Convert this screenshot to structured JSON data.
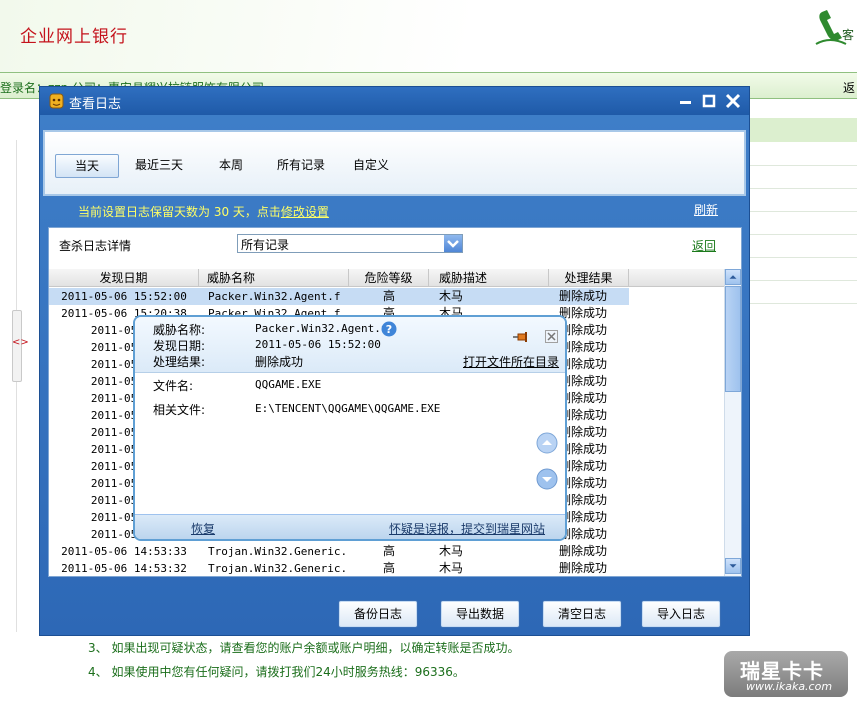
{
  "bank": {
    "title": "企业网上银行",
    "phone_label": "客",
    "login_label": "登录名：",
    "company_text": "zzp   公司：惠安县耀兴拉链服饰有限公司",
    "back_label": "返",
    "notices": [
      "3、 如果出现可疑状态，请查看您的账户余额或账户明细，以确定转账是否成功。",
      "4、 如果使用中您有任何疑问，请拨打我们24小时服务热线：96336。"
    ],
    "left_tab": "<>"
  },
  "dialog": {
    "title": "查看日志",
    "tabs": [
      "当天",
      "最近三天",
      "本周",
      "所有记录",
      "自定义"
    ],
    "retention_prefix": "当前设置日志保留天数为 30 天，点击",
    "retention_link": "修改设置",
    "refresh": "刷新",
    "detail_label": "查杀日志详情",
    "filter_value": "所有记录",
    "return": "返回",
    "columns": [
      "发现日期",
      "威胁名称",
      "危险等级",
      "威胁描述",
      "处理结果"
    ],
    "rows": [
      {
        "date": "2011-05-06 15:52:00",
        "name": "Packer.Win32.Agent.f",
        "level": "高",
        "desc": "木马",
        "result": "删除成功"
      },
      {
        "date": "2011-05-06 15:20:38",
        "name": "Packer.Win32.Agent.f",
        "level": "高",
        "desc": "木马",
        "result": "删除成功"
      },
      {
        "date": "2011-05-06",
        "name": "",
        "level": "",
        "desc": "",
        "result": "删除成功"
      },
      {
        "date": "2011-05-06",
        "name": "",
        "level": "",
        "desc": "",
        "result": "删除成功"
      },
      {
        "date": "2011-05-06",
        "name": "",
        "level": "",
        "desc": "",
        "result": "删除成功"
      },
      {
        "date": "2011-05-06",
        "name": "",
        "level": "",
        "desc": "",
        "result": "删除成功"
      },
      {
        "date": "2011-05-06",
        "name": "",
        "level": "",
        "desc": "",
        "result": "删除成功"
      },
      {
        "date": "2011-05-06",
        "name": "",
        "level": "",
        "desc": "",
        "result": "删除成功"
      },
      {
        "date": "2011-05-06",
        "name": "",
        "level": "",
        "desc": "",
        "result": "删除成功"
      },
      {
        "date": "2011-05-06",
        "name": "",
        "level": "",
        "desc": "",
        "result": "删除成功"
      },
      {
        "date": "2011-05-06",
        "name": "",
        "level": "",
        "desc": "",
        "result": "删除成功"
      },
      {
        "date": "2011-05-06",
        "name": "",
        "level": "",
        "desc": "",
        "result": "删除成功"
      },
      {
        "date": "2011-05-06",
        "name": "",
        "level": "",
        "desc": "",
        "result": "删除成功"
      },
      {
        "date": "2011-05-06",
        "name": "",
        "level": "",
        "desc": "",
        "result": "删除成功"
      },
      {
        "date": "2011-05-06",
        "name": "",
        "level": "",
        "desc": "",
        "result": "删除成功"
      },
      {
        "date": "2011-05-06 14:53:33",
        "name": "Trojan.Win32.Generic...",
        "level": "高",
        "desc": "木马",
        "result": "删除成功"
      },
      {
        "date": "2011-05-06 14:53:32",
        "name": "Trojan.Win32.Generic...",
        "level": "高",
        "desc": "木马",
        "result": "删除成功"
      }
    ],
    "buttons": [
      "备份日志",
      "导出数据",
      "清空日志",
      "导入日志"
    ]
  },
  "popup": {
    "threat_name_label": "威胁名称:",
    "threat_name": "Packer.Win32.Agent.f",
    "found_date_label": "发现日期:",
    "found_date": "2011-05-06 15:52:00",
    "result_label": "处理结果:",
    "result": "删除成功",
    "open_folder": "打开文件所在目录",
    "file_name_label": "文件名:",
    "file_name": "QQGAME.EXE",
    "related_file_label": "相关文件:",
    "related_file": "E:\\TENCENT\\QQGAME\\QQGAME.EXE",
    "restore": "恢复",
    "report": "怀疑是误报，提交到瑞星网站"
  },
  "watermark": {
    "main": "瑞星卡卡",
    "url": "www.ikaka.com"
  },
  "colors": {
    "dialog_blue": "#2d68b6",
    "highlight_yellow": "#ffff66",
    "selected_row": "#c6dcf4",
    "bank_red": "#c4121b",
    "bank_green": "#1b6e1b"
  },
  "icons": {
    "app": "rising-lion-icon",
    "phone": "phone-icon",
    "help": "help-icon",
    "pin": "pin-icon"
  }
}
